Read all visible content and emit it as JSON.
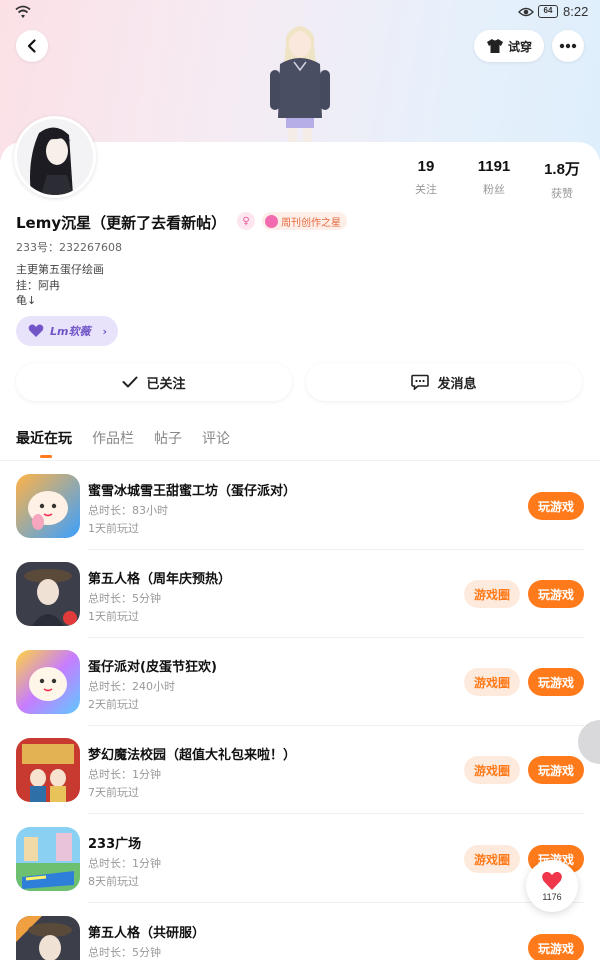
{
  "status_bar": {
    "time": "8:22",
    "battery": "64"
  },
  "header": {
    "tryon_label": "试穿"
  },
  "profile": {
    "username": "Lemy沉星（更新了去看新帖）",
    "gender_symbol": "♀",
    "star_badge": "周刊创作之星",
    "uid": "233号：232267608",
    "bio_lines": [
      "主更第五蛋仔绘画",
      "挂：阿冉",
      "龟↓"
    ],
    "guild": "Lm软薇",
    "stats": [
      {
        "value": "19",
        "label": "关注"
      },
      {
        "value": "1191",
        "label": "粉丝"
      },
      {
        "value": "1.8万",
        "label": "获赞"
      }
    ],
    "follow_label": "已关注",
    "message_label": "发消息"
  },
  "tabs": [
    "最近在玩",
    "作品栏",
    "帖子",
    "评论"
  ],
  "games": [
    {
      "title": "蜜雪冰城雪王甜蜜工坊（蛋仔派对）",
      "duration": "总时长：83小时",
      "last_played": "1天前玩过",
      "has_circle": false
    },
    {
      "title": "第五人格（周年庆预热）",
      "duration": "总时长：5分钟",
      "last_played": "1天前玩过",
      "has_circle": true
    },
    {
      "title": "蛋仔派对(皮蛋节狂欢)",
      "duration": "总时长：240小时",
      "last_played": "2天前玩过",
      "has_circle": true
    },
    {
      "title": "梦幻魔法校园（超值大礼包来啦！）",
      "duration": "总时长：1分钟",
      "last_played": "7天前玩过",
      "has_circle": true
    },
    {
      "title": "233广场",
      "duration": "总时长：1分钟",
      "last_played": "8天前玩过",
      "has_circle": true
    },
    {
      "title": "第五人格（共研服）",
      "duration": "总时长：5分钟",
      "last_played": "",
      "has_circle": false
    }
  ],
  "game_buttons": {
    "play": "玩游戏",
    "circle": "游戏圈"
  },
  "float_like": {
    "count": "1176"
  },
  "colors": {
    "accent": "#ff7a1a",
    "accent_light": "#fdeadd",
    "guild": "#7256c8"
  },
  "icons": [
    "wifi-icon",
    "eye-icon",
    "back-arrow-icon",
    "shirt-icon",
    "more-dots-icon",
    "checkmark-icon",
    "chat-bubble-icon",
    "heart-icon",
    "chevron-right-icon"
  ]
}
